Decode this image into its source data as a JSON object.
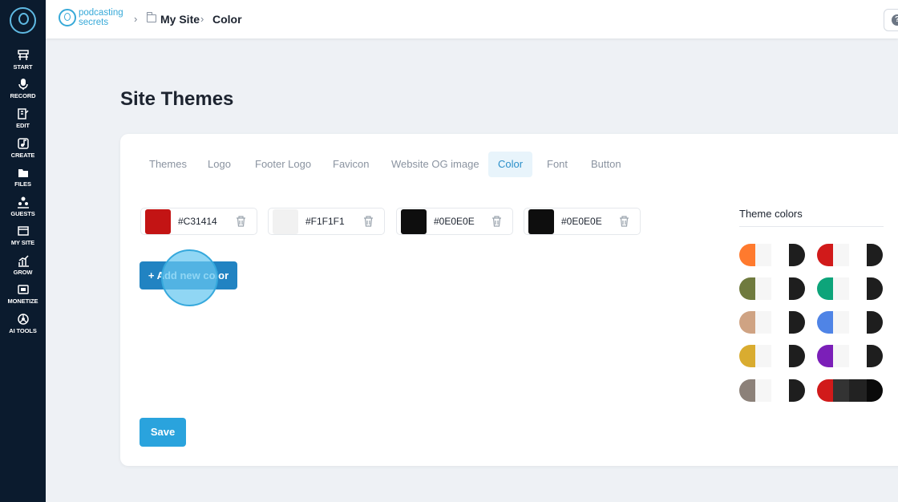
{
  "sidebar": {
    "items": [
      {
        "label": "START",
        "icon": "start-icon"
      },
      {
        "label": "RECORD",
        "icon": "microphone-icon"
      },
      {
        "label": "EDIT",
        "icon": "edit-icon"
      },
      {
        "label": "CREATE",
        "icon": "music-note-icon"
      },
      {
        "label": "FILES",
        "icon": "files-icon"
      },
      {
        "label": "GUESTS",
        "icon": "guests-icon"
      },
      {
        "label": "MY SITE",
        "icon": "my-site-icon"
      },
      {
        "label": "GROW",
        "icon": "grow-chart-icon"
      },
      {
        "label": "MONETIZE",
        "icon": "monetize-icon"
      },
      {
        "label": "AI TOOLS",
        "icon": "ai-tools-icon"
      }
    ]
  },
  "header": {
    "brand_line1": "podcasting",
    "brand_line2": "secrets",
    "breadcrumb": [
      "My Site",
      "Color"
    ],
    "help": "?"
  },
  "page": {
    "title": "Site Themes"
  },
  "tabs": [
    "Themes",
    "Logo",
    "Footer Logo",
    "Favicon",
    "Website OG image",
    "Color",
    "Font",
    "Button"
  ],
  "active_tab": "Color",
  "colors": [
    {
      "hex": "#C31414",
      "swatch": "#c31414"
    },
    {
      "hex": "#F1F1F1",
      "swatch": "#f1f1f1"
    },
    {
      "hex": "#0E0E0E",
      "swatch": "#0e0e0e"
    },
    {
      "hex": "#0E0E0E",
      "swatch": "#0e0e0e"
    }
  ],
  "buttons": {
    "add_color": "+ Add new color",
    "save": "Save"
  },
  "theme_colors": {
    "heading": "Theme colors",
    "palettes": [
      [
        "#ff7a2e",
        "#f6f6f6",
        "#ffffff",
        "#1e1e1e"
      ],
      [
        "#d11a1a",
        "#f6f6f6",
        "#ffffff",
        "#1e1e1e"
      ],
      [
        "#6f7a3e",
        "#f6f6f6",
        "#ffffff",
        "#1e1e1e"
      ],
      [
        "#0da47a",
        "#f6f6f6",
        "#ffffff",
        "#1e1e1e"
      ],
      [
        "#cfa383",
        "#f6f6f6",
        "#ffffff",
        "#1e1e1e"
      ],
      [
        "#4f84e6",
        "#f6f6f6",
        "#ffffff",
        "#1e1e1e"
      ],
      [
        "#d9ac30",
        "#f6f6f6",
        "#ffffff",
        "#1e1e1e"
      ],
      [
        "#7b1fb8",
        "#f6f6f6",
        "#ffffff",
        "#1e1e1e"
      ],
      [
        "#8c8179",
        "#f6f6f6",
        "#ffffff",
        "#1e1e1e"
      ],
      [
        "#d11a1a",
        "#333333",
        "#222222",
        "#0a0a0a"
      ]
    ]
  },
  "colors_theme": {
    "sidebar_bg": "#0b1b2e",
    "accent": "#2aa3dd",
    "tab_active": "#2b8fc9"
  }
}
